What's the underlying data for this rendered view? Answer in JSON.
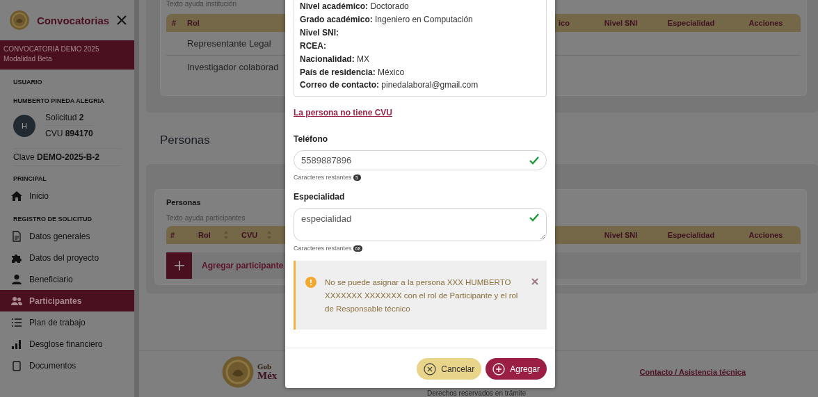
{
  "sidebar": {
    "title": "Convocatorias",
    "program": {
      "name": "CONVOCATORIA DEMO 2025",
      "modality": "Modalidad Beta"
    },
    "user_heading": "USUARIO",
    "user_name": "HUMBERTO PINEDA ALEGRIA",
    "avatar_initial": "H",
    "solicitud": "Solicitud **2**",
    "cvu": "CVU **894170**",
    "clave": "Clave **DEMO-2025-B-2**",
    "sections": [
      {
        "heading": "PRINCIPAL",
        "items": [
          {
            "label": "Inicio",
            "selected": false
          }
        ]
      },
      {
        "heading": "REGISTRO DE SOLICITUD",
        "items": [
          {
            "label": "Datos generales",
            "selected": false
          },
          {
            "label": "Datos del proyecto",
            "selected": false
          },
          {
            "label": "Beneficiario",
            "selected": false
          },
          {
            "label": "Participantes",
            "selected": true
          },
          {
            "label": "Plan de trabajo",
            "selected": false
          },
          {
            "label": "Desglose financiero",
            "selected": false
          },
          {
            "label": "Documentos",
            "selected": false
          }
        ]
      }
    ]
  },
  "institution": {
    "help": "Texto ayuda institución",
    "columns_left": [
      "#",
      "Rol"
    ],
    "columns_right": [
      "ico",
      "Nivel SNI",
      "Especialidad",
      "Acciones"
    ],
    "rows": [
      "Representante Legal",
      "Investigador colaborad"
    ]
  },
  "personas": {
    "section_title": "Personas",
    "title": "Personas",
    "help": "Texto ayuda participantes",
    "columns_left": [
      "#",
      "Rol",
      "CVU"
    ],
    "columns_right": [
      "Nivel SNI",
      "Especialidad",
      "Acciones"
    ],
    "add_label": "Agregar participante"
  },
  "footer": {
    "gob": "Gob",
    "mexico": "Méx",
    "rights": "Derechos reservados en trámite",
    "contact": "Contacto / Asistencia técnica"
  },
  "modal": {
    "details": [
      {
        "label": "Nivel académico:",
        "value": "Doctorado"
      },
      {
        "label": "Grado académico:",
        "value": "Ingeniero en Computación"
      },
      {
        "label": "Nivel SNI:"
      },
      {
        "label": "RCEA:"
      },
      {
        "label": "Nacionalidad:",
        "value": "MX"
      },
      {
        "label": "País de residencia:",
        "value": "México"
      },
      {
        "label": "Correo de contacto:",
        "value": "pinedalaboral@gmail.com"
      }
    ],
    "no_cvu_link": "La persona no tiene CVU",
    "fields": [
      {
        "kind": "input",
        "label": "Teléfono",
        "value": "5589887896",
        "valid": true,
        "remaining_label": "Caracteres restantes",
        "remaining": "5"
      },
      {
        "kind": "textarea",
        "label": "Especialidad",
        "value": "especialidad",
        "valid": true,
        "remaining_label": "Caracteres restantes",
        "remaining": "68"
      }
    ],
    "alert": {
      "message": "No se puede asignar a la persona XXX HUMBERTO XXXXXXX XXXXXXX con el rol de Participante y el rol de Responsable técnico"
    },
    "buttons": [
      {
        "label": "Cancelar",
        "kind": "cancel"
      },
      {
        "label": "Agregar",
        "kind": "primary"
      }
    ]
  }
}
